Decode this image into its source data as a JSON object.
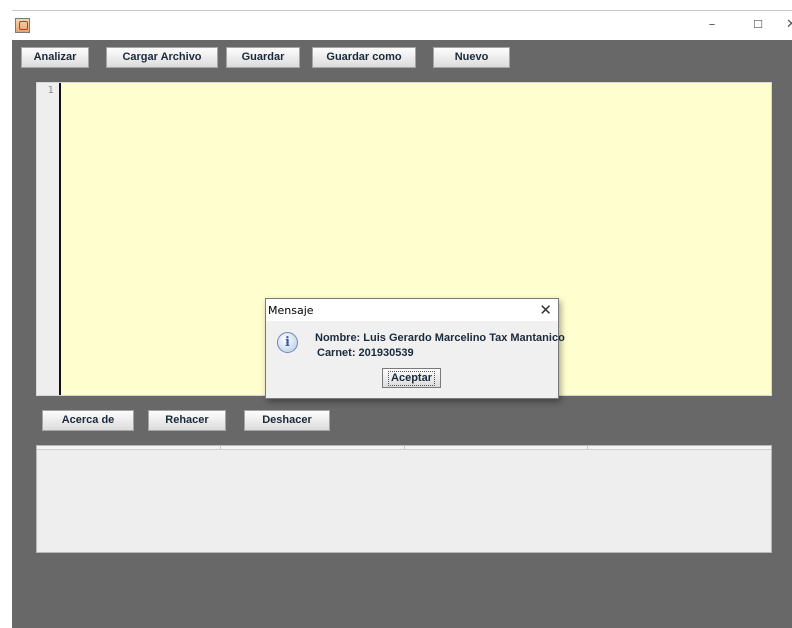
{
  "window": {
    "minimize_glyph": "–",
    "maximize_glyph": "☐",
    "close_glyph": "✕"
  },
  "toolbar": {
    "buttons": [
      "Analizar",
      "Cargar Archivo",
      "Guardar",
      "Guardar como",
      "Nuevo"
    ]
  },
  "editor": {
    "line_number": "1",
    "background": "#fffecf"
  },
  "actions": {
    "buttons": [
      "Acerca de",
      "Rehacer",
      "Deshacer"
    ]
  },
  "dialog": {
    "title": "Mensaje",
    "close_glyph": "✕",
    "icon": "info-icon",
    "icon_glyph": "i",
    "line1": "Nombre: Luis Gerardo Marcelino Tax Mantanico",
    "line2": "Carnet: 201930539",
    "ok_label": "Aceptar"
  }
}
